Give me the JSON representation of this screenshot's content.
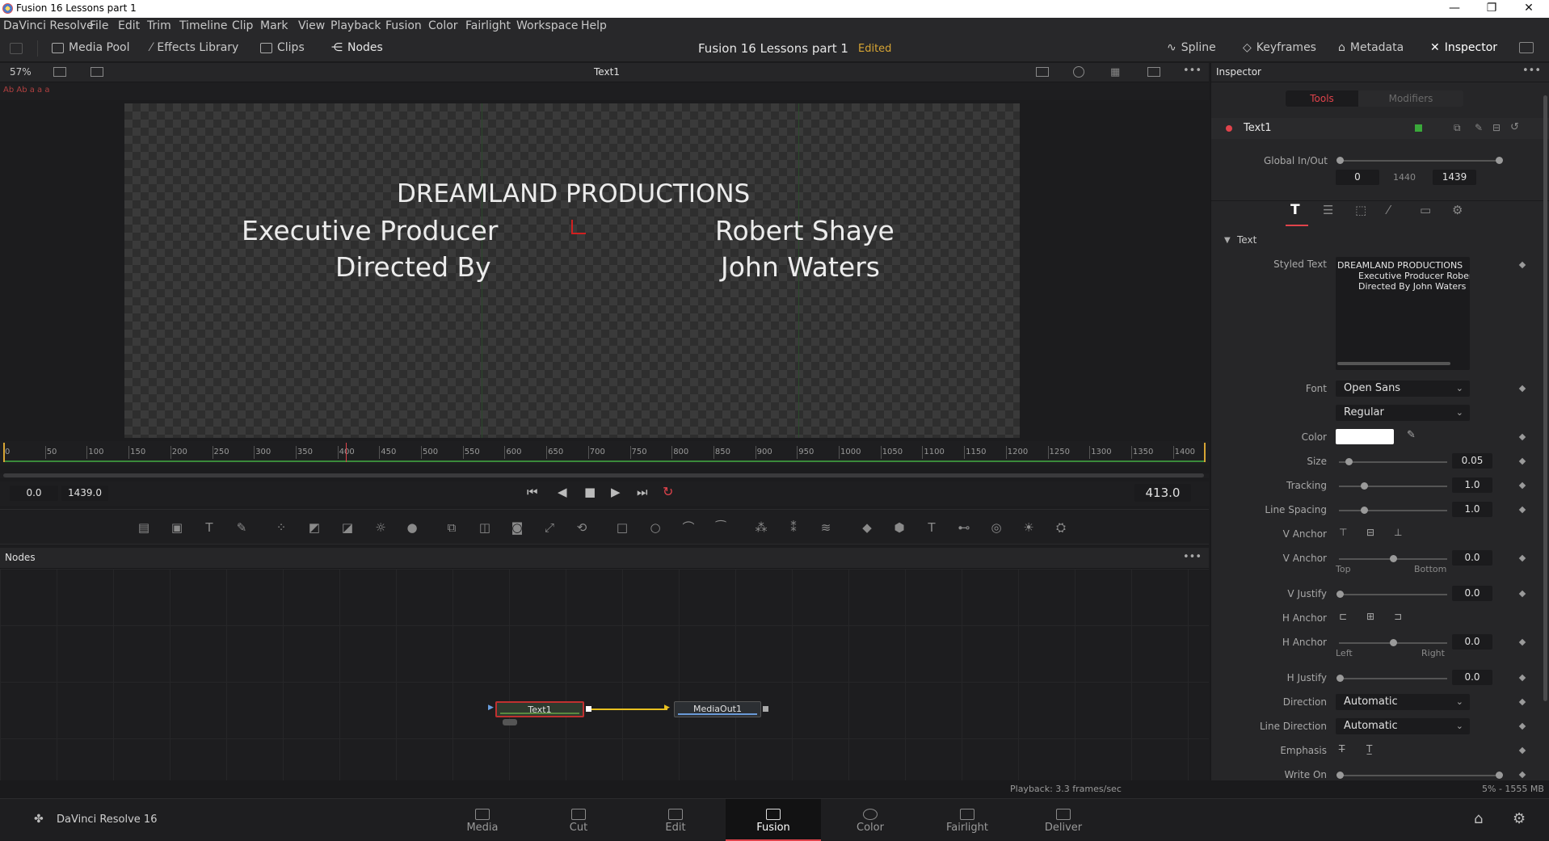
{
  "window": {
    "title": "Fusion 16 Lessons part 1",
    "minimize": "—",
    "maximize": "❐",
    "close": "✕"
  },
  "menu": [
    "DaVinci Resolve",
    "File",
    "Edit",
    "Trim",
    "Timeline",
    "Clip",
    "Mark",
    "View",
    "Playback",
    "Fusion",
    "Color",
    "Fairlight",
    "Workspace",
    "Help"
  ],
  "toolbar": {
    "media_pool": "Media Pool",
    "effects_library": "Effects Library",
    "clips": "Clips",
    "nodes": "Nodes",
    "project_title": "Fusion 16 Lessons part 1",
    "edited": "Edited",
    "spline": "Spline",
    "keyframes": "Keyframes",
    "metadata": "Metadata",
    "inspector": "Inspector"
  },
  "viewer": {
    "zoom": "57%",
    "name": "Text1",
    "canvas_text": {
      "line1": "DREAMLAND PRODUCTIONS",
      "line2_left": "Executive Producer",
      "line2_right": "Robert Shaye",
      "line3_left": "Directed By",
      "line3_right": "John Waters"
    }
  },
  "ruler": {
    "ticks": [
      "0",
      "50",
      "100",
      "150",
      "200",
      "250",
      "300",
      "350",
      "400",
      "450",
      "500",
      "550",
      "600",
      "650",
      "700",
      "750",
      "800",
      "850",
      "900",
      "950",
      "1000",
      "1050",
      "1100",
      "1150",
      "1200",
      "1250",
      "1300",
      "1350",
      "1400"
    ],
    "playhead": 413
  },
  "transport": {
    "start": "0.0",
    "end": "1439.0",
    "current": "413.0"
  },
  "nodes_panel": {
    "title": "Nodes",
    "node1": "Text1",
    "node2": "MediaOut1"
  },
  "status": {
    "playback": "Playback: 3.3 frames/sec",
    "memory": "5% - 1555 MB"
  },
  "pages": [
    "Media",
    "Cut",
    "Edit",
    "Fusion",
    "Color",
    "Fairlight",
    "Deliver"
  ],
  "app_name": "DaVinci Resolve 16",
  "inspector": {
    "title": "Inspector",
    "tab_tools": "Tools",
    "tab_modifiers": "Modifiers",
    "tool_name": "Text1",
    "global_inout_label": "Global In/Out",
    "global_in": "0",
    "global_mid": "1440",
    "global_out": "1439",
    "section_text": "Text",
    "styled_text_label": "Styled Text",
    "styled_text_l1": "DREAMLAND PRODUCTIONS",
    "styled_text_l2": "Executive Producer     Robert S",
    "styled_text_l3": "Directed By    John Waters",
    "font_label": "Font",
    "font": "Open Sans",
    "style": "Regular",
    "color_label": "Color",
    "size_label": "Size",
    "size": "0.05",
    "tracking_label": "Tracking",
    "tracking": "1.0",
    "line_spacing_label": "Line Spacing",
    "line_spacing": "1.0",
    "vanchor_label": "V Anchor",
    "vanchor2_label": "V Anchor",
    "vanchor": "0.0",
    "top": "Top",
    "bottom": "Bottom",
    "vjustify_label": "V Justify",
    "vjustify": "0.0",
    "hanchor_label": "H Anchor",
    "hanchor2_label": "H Anchor",
    "hanchor": "0.0",
    "left": "Left",
    "right": "Right",
    "hjustify_label": "H Justify",
    "hjustify": "0.0",
    "direction_label": "Direction",
    "direction": "Automatic",
    "line_direction_label": "Line Direction",
    "line_direction": "Automatic",
    "emphasis_label": "Emphasis",
    "writeon_label": "Write On"
  },
  "colors": {
    "accent_red": "#e0434b",
    "edited": "#d7a534",
    "connector": "#e8c020"
  }
}
